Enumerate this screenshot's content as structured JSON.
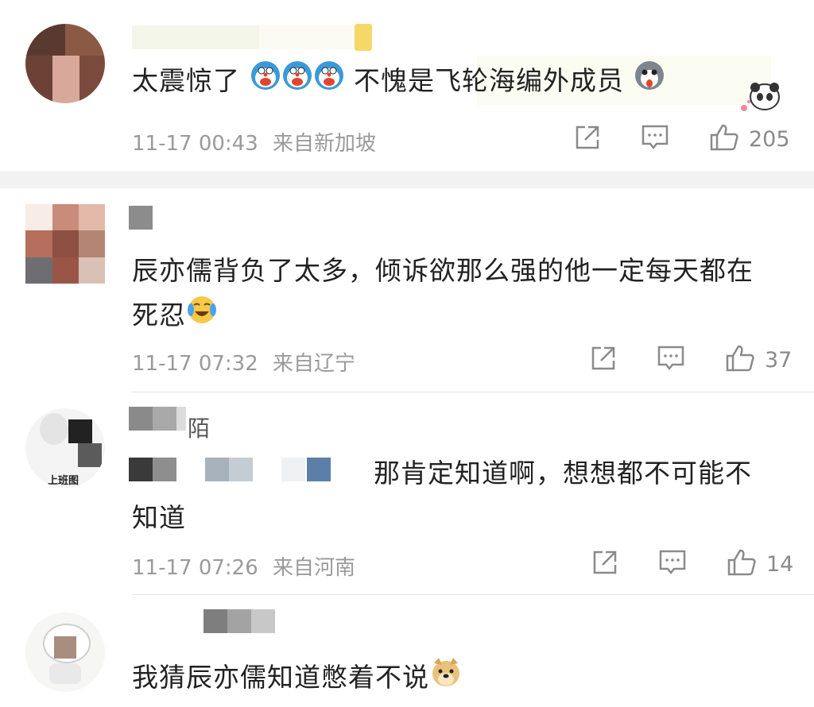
{
  "comments": [
    {
      "name_suffix": "",
      "text_a": "太震惊了",
      "text_b": "不愧是飞轮海编外成员",
      "time": "11-17 00:43",
      "location": "来自新加坡",
      "likes": "205"
    },
    {
      "name_suffix": "",
      "text": "辰亦儒背负了太多，倾诉欲那么强的他一定每天都在死忍",
      "time": "11-17 07:32",
      "location": "来自辽宁",
      "likes": "37"
    },
    {
      "name_suffix": "陌",
      "avatar_label": "上班图",
      "text_a": "那肯定知道啊，想想都不可能不",
      "text_b": "知道",
      "time": "11-17 07:26",
      "location": "来自河南",
      "likes": "14"
    },
    {
      "name_suffix": "",
      "text": "我猜辰亦儒知道憋着不说"
    }
  ],
  "icons": {
    "share": "share-icon",
    "comment": "comment-icon",
    "like": "thumbs-up-icon"
  },
  "colors": {
    "text": "#222222",
    "meta": "#9a9a9a",
    "separator": "#f2f2f2"
  }
}
